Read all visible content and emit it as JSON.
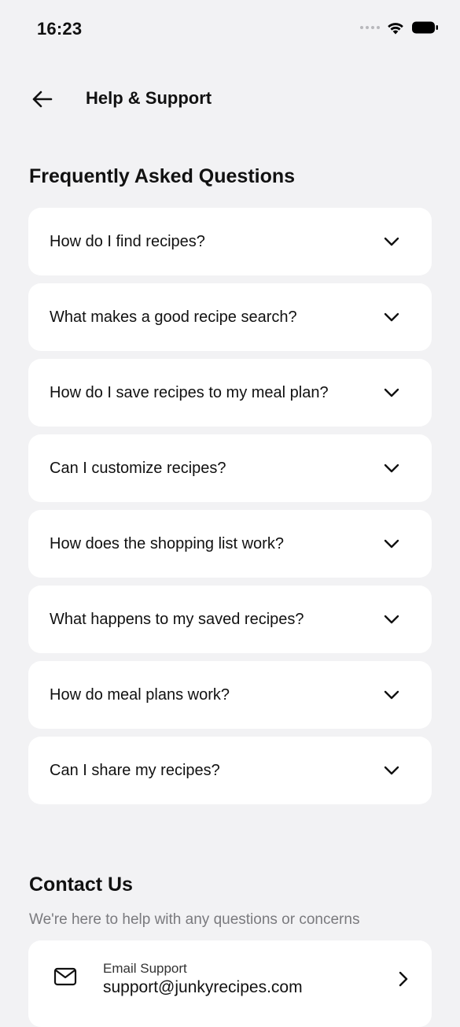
{
  "status_bar": {
    "time": "16:23"
  },
  "header": {
    "title": "Help & Support"
  },
  "faq": {
    "title": "Frequently Asked Questions",
    "items": [
      {
        "question": "How do I find recipes?"
      },
      {
        "question": "What makes a good recipe search?"
      },
      {
        "question": "How do I save recipes to my meal plan?"
      },
      {
        "question": "Can I customize recipes?"
      },
      {
        "question": "How does the shopping list work?"
      },
      {
        "question": "What happens to my saved recipes?"
      },
      {
        "question": "How do meal plans work?"
      },
      {
        "question": "Can I share my recipes?"
      }
    ]
  },
  "contact": {
    "title": "Contact Us",
    "subtitle": "We're here to help with any questions or concerns",
    "email": {
      "label": "Email Support",
      "value": "support@junkyrecipes.com"
    }
  },
  "icons": {
    "back": "arrow-left-icon",
    "chevron": "chevron-down-icon",
    "mail": "mail-icon",
    "contact_chevron": "chevron-right-icon"
  },
  "colors": {
    "background": "#f2f2f4",
    "card": "#ffffff",
    "text": "#111111",
    "muted": "#7a7a7e"
  }
}
